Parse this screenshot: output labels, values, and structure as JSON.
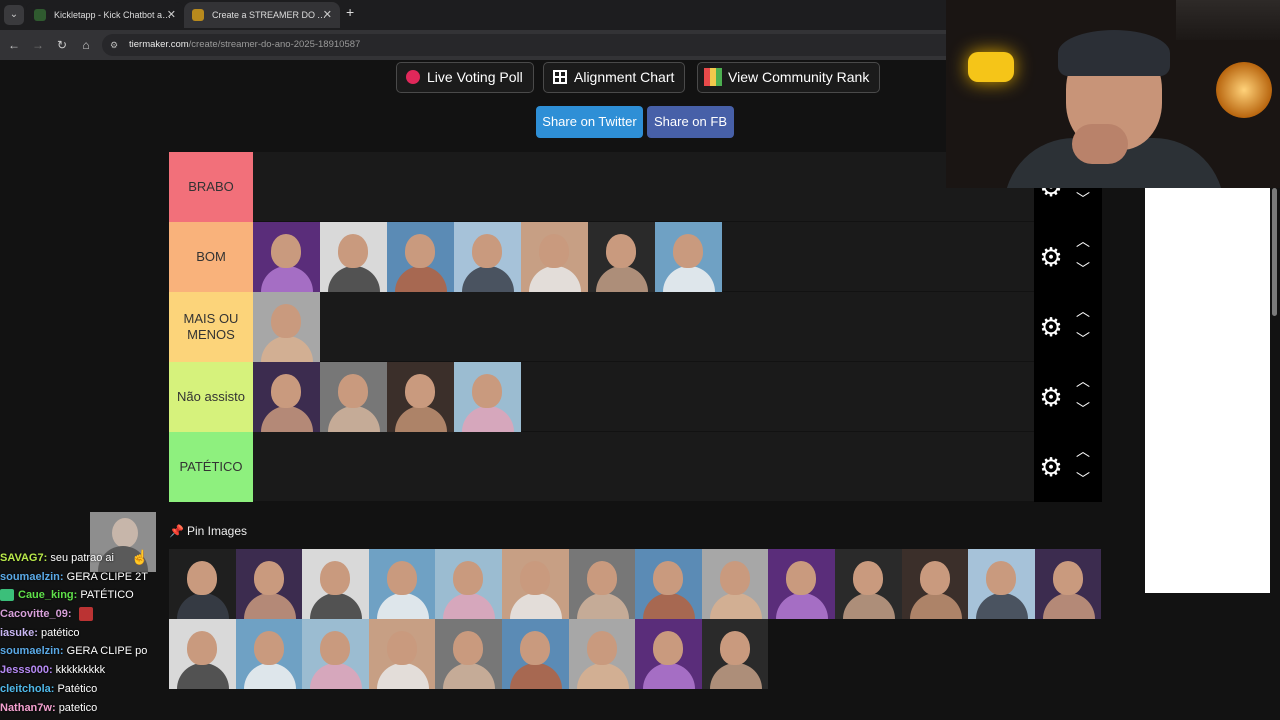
{
  "browser": {
    "tabs": [
      {
        "title": "Kickletapp - Kick Chatbot and",
        "close": "✕"
      },
      {
        "title": "Create a STREAMER DO ANO (",
        "close": "✕"
      }
    ],
    "new_tab": "+",
    "url_host": "tiermaker.com",
    "url_path": "/create/streamer-do-ano-2025-18910587"
  },
  "toolbar": {
    "live_voting": "Live Voting Poll",
    "alignment": "Alignment Chart",
    "community_rank": "View Community Rank",
    "share_twitter": "Share on Twitter",
    "share_fb": "Share on FB"
  },
  "tiers": [
    {
      "label": "BRABO",
      "color": "#f2707a",
      "items": 0
    },
    {
      "label": "BOM",
      "color": "#f9b27b",
      "items": 7
    },
    {
      "label": "MAIS OU MENOS",
      "color": "#fcd47a",
      "items": 1
    },
    {
      "label": "Não assisto",
      "color": "#d6f27c",
      "items": 4
    },
    {
      "label": "PATÉTICO",
      "color": "#8ef07e",
      "items": 0
    }
  ],
  "pin": {
    "label": "Pin Images"
  },
  "pool_count": 23,
  "chat": [
    {
      "user": "SAVAG7:",
      "color": "#b9e94a",
      "msg": "seu patrao ai",
      "badge": false,
      "emote": false
    },
    {
      "user": "soumaelzin:",
      "color": "#5aa9e6",
      "msg": "GERA CLIPE 2T",
      "badge": false,
      "emote": false
    },
    {
      "user": "Caue_king:",
      "color": "#5fe04a",
      "msg": "PATÉTICO",
      "badge": true,
      "emote": false
    },
    {
      "user": "Cacovitte_09:",
      "color": "#d7a0d9",
      "msg": "",
      "badge": false,
      "emote": true
    },
    {
      "user": "iasuke:",
      "color": "#c8b6f2",
      "msg": "patético",
      "badge": false,
      "emote": false
    },
    {
      "user": "soumaelzin:",
      "color": "#5aa9e6",
      "msg": "GERA CLIPE po",
      "badge": false,
      "emote": false
    },
    {
      "user": "Jesss000:",
      "color": "#b68af5",
      "msg": "kkkkkkkkk",
      "badge": false,
      "emote": false
    },
    {
      "user": "cleitchola:",
      "color": "#4fb8e8",
      "msg": "Patético",
      "badge": false,
      "emote": false
    },
    {
      "user": "Nathan7w:",
      "color": "#f5a1d0",
      "msg": "patetico",
      "badge": false,
      "emote": false
    }
  ]
}
